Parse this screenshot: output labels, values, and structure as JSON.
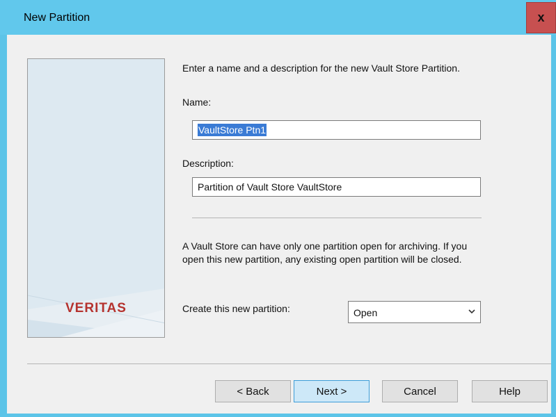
{
  "window": {
    "title": "New Partition",
    "close_label": "x"
  },
  "banner": {
    "logo_text": "VERITAS"
  },
  "instructions": "Enter a name and a description for the new Vault Store Partition.",
  "name_field": {
    "label": "Name:",
    "value": "VaultStore Ptn1"
  },
  "description_field": {
    "label": "Description:",
    "value": "Partition of Vault Store VaultStore"
  },
  "info_text_line1": "A Vault Store can have only one partition open for archiving. If you",
  "info_text_line2": "open this new partition, any existing open partition will be closed.",
  "create": {
    "label": "Create this new partition:",
    "selected": "Open"
  },
  "buttons": {
    "back": "< Back",
    "next": "Next >",
    "cancel": "Cancel",
    "help": "Help"
  },
  "colors": {
    "titlebar": "#61c8ec",
    "close": "#c75050",
    "logo": "#b5322e",
    "selection": "#3a7bd5"
  }
}
